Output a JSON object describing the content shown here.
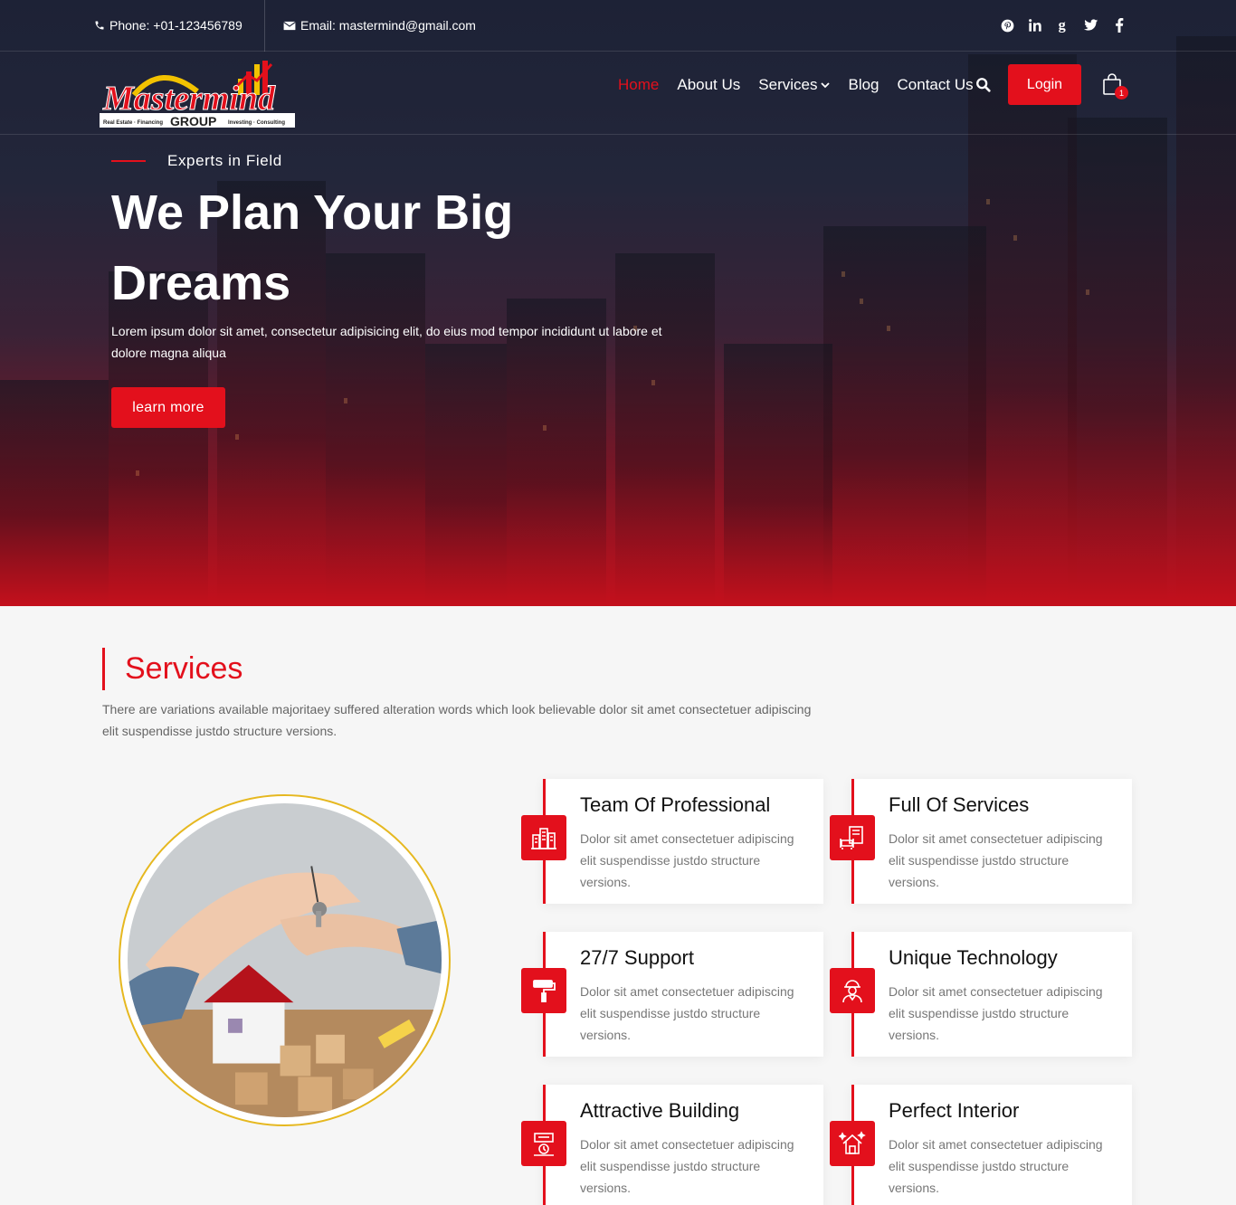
{
  "colors": {
    "accent": "#e3101c",
    "ring": "#e6b820",
    "dark": "#1d2236"
  },
  "topbar": {
    "phone": "Phone: +01-123456789",
    "email": "Email: mastermind@gmail.com",
    "social": [
      "pinterest-icon",
      "linkedin-icon",
      "google-plus-icon",
      "twitter-icon",
      "facebook-icon"
    ]
  },
  "logo": {
    "wordmark": "Mastermind",
    "group": "GROUP",
    "tags_left": "Real Estate · Financing",
    "tags_right": "Investing · Consulting"
  },
  "nav": {
    "items": [
      "Home",
      "About Us",
      "Services",
      "Blog",
      "Contact Us"
    ],
    "login_label": "Login",
    "cart_count": "1"
  },
  "hero": {
    "eyebrow": "Experts in Field",
    "title": "We Plan Your Big Dreams",
    "desc": "Lorem ipsum dolor sit amet, consectetur adipisicing elit, do eius mod tempor incididunt ut labore et dolore magna aliqua",
    "button": "learn more"
  },
  "services": {
    "title": "Services",
    "desc": "There are variations available majoritaey suffered alteration words which look believable dolor sit amet consectetuer adipiscing elit suspendisse justdo structure versions.",
    "cards": [
      {
        "title": "Team Of Professional",
        "text": "Dolor sit amet consectetuer adipiscing elit suspendisse justdo structure versions.",
        "icon": "buildings-icon"
      },
      {
        "title": "Full Of Services",
        "text": "Dolor sit amet consectetuer adipiscing elit suspendisse justdo structure versions.",
        "icon": "sofa-icon"
      },
      {
        "title": "27/7 Support",
        "text": "Dolor sit amet consectetuer adipiscing elit suspendisse justdo structure versions.",
        "icon": "paint-roller-icon"
      },
      {
        "title": "Unique Technology",
        "text": "Dolor sit amet consectetuer adipiscing elit suspendisse justdo structure versions.",
        "icon": "worker-icon"
      },
      {
        "title": "Attractive Building",
        "text": "Dolor sit amet consectetuer adipiscing elit suspendisse justdo structure versions.",
        "icon": "blueprint-icon"
      },
      {
        "title": "Perfect Interior",
        "text": "Dolor sit amet consectetuer adipiscing elit suspendisse justdo structure versions.",
        "icon": "house-sparkle-icon"
      }
    ]
  }
}
